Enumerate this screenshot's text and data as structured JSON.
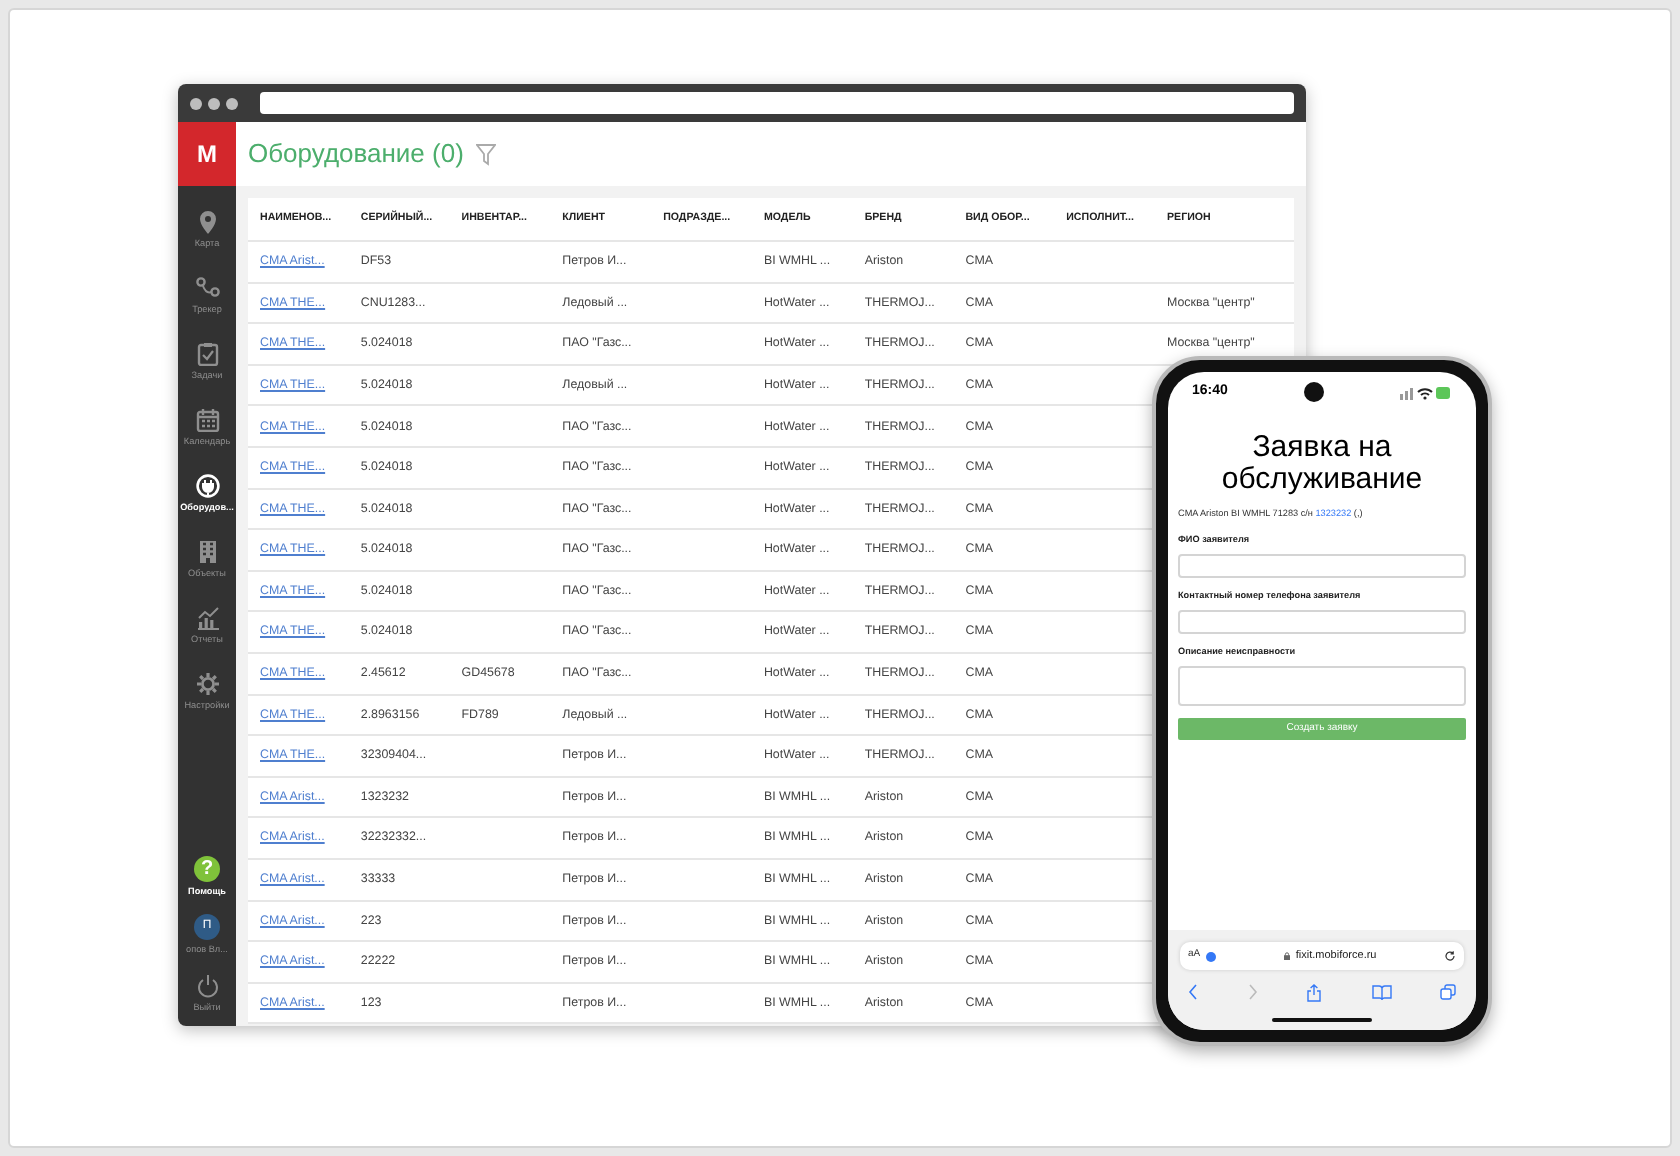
{
  "app": {
    "logo": "M",
    "title": "Оборудование (0)"
  },
  "sidebar": {
    "items": [
      {
        "label": "Карта",
        "kind": "pin",
        "selected": false
      },
      {
        "label": "Трекер",
        "kind": "route",
        "selected": false
      },
      {
        "label": "Задачи",
        "kind": "clipboard",
        "selected": false
      },
      {
        "label": "Календарь",
        "kind": "calendar",
        "selected": false
      },
      {
        "label": "Оборудов...",
        "kind": "plug",
        "selected": true
      },
      {
        "label": "Объекты",
        "kind": "building",
        "selected": false
      },
      {
        "label": "Отчеты",
        "kind": "chart",
        "selected": false
      },
      {
        "label": "Настройки",
        "kind": "gear",
        "selected": false
      }
    ],
    "bottom": [
      {
        "label": "Помощь",
        "kind": "help",
        "glyph": "?"
      },
      {
        "label": "опов Вл...",
        "kind": "avatar",
        "glyph": "П"
      },
      {
        "label": "Выйти",
        "kind": "power"
      }
    ]
  },
  "table": {
    "columns": [
      {
        "label": "НАИМЕНОВ...",
        "kind": "link"
      },
      {
        "label": "СЕРИЙНЫЙ...",
        "kind": "text"
      },
      {
        "label": "ИНВЕНТАР...",
        "kind": "text"
      },
      {
        "label": "КЛИЕНТ",
        "kind": "text"
      },
      {
        "label": "ПОДРАЗДЕ...",
        "kind": "text"
      },
      {
        "label": "МОДЕЛЬ",
        "kind": "text"
      },
      {
        "label": "БРЕНД",
        "kind": "text"
      },
      {
        "label": "ВИД ОБОР...",
        "kind": "text"
      },
      {
        "label": "ИСПОЛНИТ...",
        "kind": "text"
      },
      {
        "label": "РЕГИОН",
        "kind": "text"
      }
    ],
    "rows": [
      [
        "CMA Arist...",
        "DF53",
        "",
        "Петров И...",
        "",
        "BI WMHL ...",
        "Ariston",
        "CMA",
        "",
        ""
      ],
      [
        "CMA THE...",
        "CNU1283...",
        "",
        "Ледовый ...",
        "",
        "HotWater ...",
        "THERMOJ...",
        "CMA",
        "",
        "Москва \"центр\""
      ],
      [
        "CMA THE...",
        "5.024018",
        "",
        "ПАО \"Газс...",
        "",
        "HotWater ...",
        "THERMOJ...",
        "CMA",
        "",
        "Москва \"центр\""
      ],
      [
        "CMA THE...",
        "5.024018",
        "",
        "Ледовый ...",
        "",
        "HotWater ...",
        "THERMOJ...",
        "CMA",
        "",
        ""
      ],
      [
        "CMA THE...",
        "5.024018",
        "",
        "ПАО \"Газс...",
        "",
        "HotWater ...",
        "THERMOJ...",
        "CMA",
        "",
        ""
      ],
      [
        "CMA THE...",
        "5.024018",
        "",
        "ПАО \"Газс...",
        "",
        "HotWater ...",
        "THERMOJ...",
        "CMA",
        "",
        ""
      ],
      [
        "CMA THE...",
        "5.024018",
        "",
        "ПАО \"Газс...",
        "",
        "HotWater ...",
        "THERMOJ...",
        "CMA",
        "",
        ""
      ],
      [
        "CMA THE...",
        "5.024018",
        "",
        "ПАО \"Газс...",
        "",
        "HotWater ...",
        "THERMOJ...",
        "CMA",
        "",
        ""
      ],
      [
        "CMA THE...",
        "5.024018",
        "",
        "ПАО \"Газс...",
        "",
        "HotWater ...",
        "THERMOJ...",
        "CMA",
        "",
        ""
      ],
      [
        "CMA THE...",
        "5.024018",
        "",
        "ПАО \"Газс...",
        "",
        "HotWater ...",
        "THERMOJ...",
        "CMA",
        "",
        ""
      ],
      [
        "CMA THE...",
        "2.45612",
        "GD45678",
        "ПАО \"Газс...",
        "",
        "HotWater ...",
        "THERMOJ...",
        "CMA",
        "",
        ""
      ],
      [
        "CMA THE...",
        "2.8963156",
        "FD789",
        "Ледовый ...",
        "",
        "HotWater ...",
        "THERMOJ...",
        "CMA",
        "",
        ""
      ],
      [
        "CMA THE...",
        "32309404...",
        "",
        "Петров И...",
        "",
        "HotWater ...",
        "THERMOJ...",
        "CMA",
        "",
        ""
      ],
      [
        "CMA Arist...",
        "1323232",
        "",
        "Петров И...",
        "",
        "BI WMHL ...",
        "Ariston",
        "CMA",
        "",
        ""
      ],
      [
        "CMA Arist...",
        "32232332...",
        "",
        "Петров И...",
        "",
        "BI WMHL ...",
        "Ariston",
        "CMA",
        "",
        ""
      ],
      [
        "CMA Arist...",
        "33333",
        "",
        "Петров И...",
        "",
        "BI WMHL ...",
        "Ariston",
        "CMA",
        "",
        ""
      ],
      [
        "CMA Arist...",
        "223",
        "",
        "Петров И...",
        "",
        "BI WMHL ...",
        "Ariston",
        "CMA",
        "",
        ""
      ],
      [
        "CMA Arist...",
        "22222",
        "",
        "Петров И...",
        "",
        "BI WMHL ...",
        "Ariston",
        "CMA",
        "",
        ""
      ],
      [
        "CMA Arist...",
        "123",
        "",
        "Петров И...",
        "",
        "BI WMHL ...",
        "Ariston",
        "CMA",
        "",
        ""
      ]
    ]
  },
  "phone": {
    "time": "16:40",
    "title": "Заявка на обслуживание",
    "subtitle": {
      "before": "CMA Ariston BI WMHL 71283 с/н ",
      "link": "1323232",
      "after": " (,)"
    },
    "fields": [
      {
        "label": "ФИО заявителя",
        "kind": "line"
      },
      {
        "label": "Контактный номер телефона заявителя",
        "kind": "line"
      },
      {
        "label": "Описание неисправности",
        "kind": "area"
      }
    ],
    "submit": "Создать заявку",
    "browser": {
      "text_size": "aA",
      "url": "fixit.mobiforce.ru"
    }
  }
}
